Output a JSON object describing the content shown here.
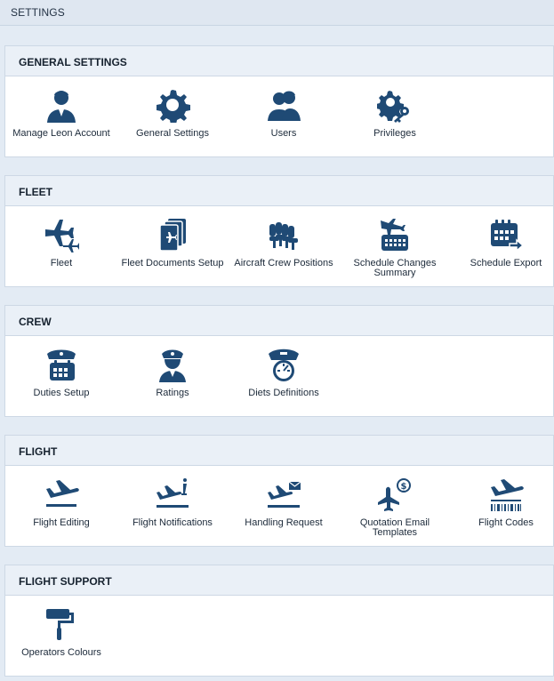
{
  "page": {
    "title": "SETTINGS"
  },
  "colors": {
    "icon": "#1f4a75",
    "header_bg": "#eaf0f7",
    "page_bg": "#e3ebf4"
  },
  "sections": [
    {
      "title": "GENERAL SETTINGS",
      "items": [
        {
          "label": "Manage Leon Account",
          "icon": "person-icon"
        },
        {
          "label": "General Settings",
          "icon": "gear-icon"
        },
        {
          "label": "Users",
          "icon": "users-icon"
        },
        {
          "label": "Privileges",
          "icon": "gear-key-icon"
        }
      ]
    },
    {
      "title": "FLEET",
      "items": [
        {
          "label": "Fleet",
          "icon": "airplanes-icon"
        },
        {
          "label": "Fleet Documents Setup",
          "icon": "documents-icon"
        },
        {
          "label": "Aircraft Crew Positions",
          "icon": "crew-seats-icon"
        },
        {
          "label": "Schedule Changes Summary",
          "icon": "schedule-changes-icon"
        },
        {
          "label": "Schedule Export",
          "icon": "calendar-export-icon"
        }
      ]
    },
    {
      "title": "CREW",
      "items": [
        {
          "label": "Duties Setup",
          "icon": "pilot-calendar-icon"
        },
        {
          "label": "Ratings",
          "icon": "pilot-icon"
        },
        {
          "label": "Diets Definitions",
          "icon": "pilot-gauge-icon"
        }
      ]
    },
    {
      "title": "FLIGHT",
      "items": [
        {
          "label": "Flight Editing",
          "icon": "departure-icon"
        },
        {
          "label": "Flight Notifications",
          "icon": "departure-info-icon"
        },
        {
          "label": "Handling Request",
          "icon": "departure-mail-icon"
        },
        {
          "label": "Quotation Email Templates",
          "icon": "plane-dollar-icon"
        },
        {
          "label": "Flight Codes",
          "icon": "departure-barcode-icon"
        }
      ]
    },
    {
      "title": "FLIGHT SUPPORT",
      "items": [
        {
          "label": "Operators Colours",
          "icon": "paint-roller-icon"
        }
      ]
    }
  ]
}
